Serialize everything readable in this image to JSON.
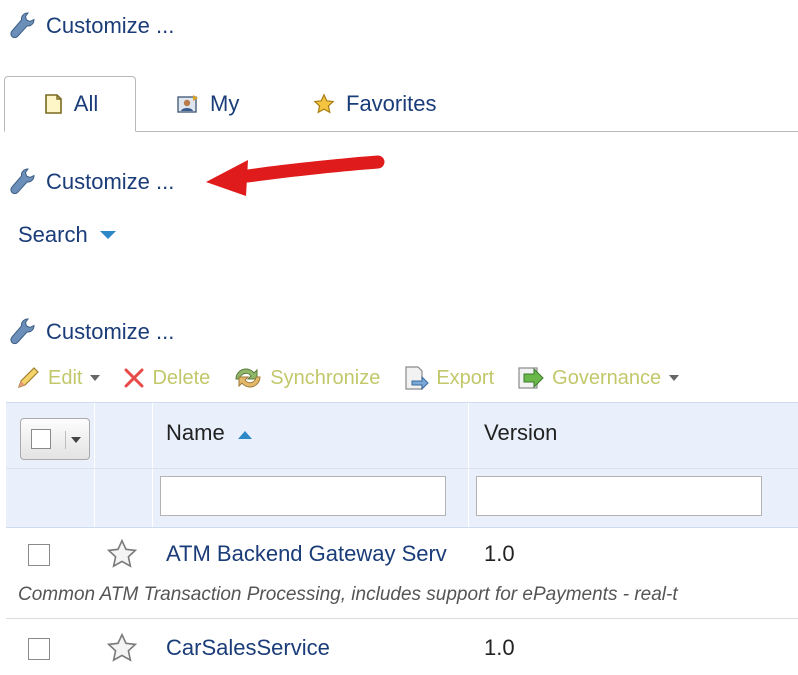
{
  "customize_label": "Customize ...",
  "tabs": [
    {
      "label": "All",
      "icon": "document-icon",
      "active": true
    },
    {
      "label": "My",
      "icon": "person-card-icon",
      "active": false
    },
    {
      "label": "Favorites",
      "icon": "star-icon",
      "active": false
    }
  ],
  "search": {
    "label": "Search"
  },
  "toolbar": {
    "edit": "Edit",
    "delete": "Delete",
    "synchronize": "Synchronize",
    "export": "Export",
    "governance": "Governance"
  },
  "grid": {
    "columns": {
      "name": "Name",
      "version": "Version"
    },
    "rows": [
      {
        "name": "ATM Backend Gateway Serv",
        "version": "1.0",
        "description": "Common ATM Transaction Processing, includes support for ePayments - real-t"
      },
      {
        "name": "CarSalesService",
        "version": "1.0"
      }
    ]
  },
  "colors": {
    "link": "#1a3c78",
    "disabled_toolbar": "#c2c86a",
    "header_bg": "#e9f0fb",
    "arrow": "#e01b1b"
  }
}
